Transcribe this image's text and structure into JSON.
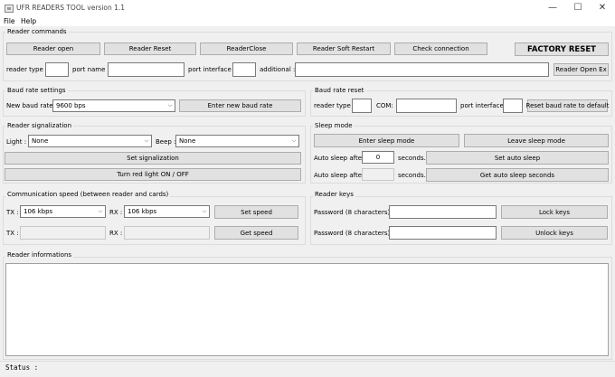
{
  "window": {
    "title": "UFR READERS TOOL version 1.1",
    "minimize_icon": "minimize-icon",
    "maximize_icon": "maximize-icon",
    "close_icon": "close-icon"
  },
  "menu": {
    "file": "File",
    "help": "Help"
  },
  "reader_commands": {
    "title": "Reader commands",
    "reader_open": "Reader open",
    "reader_reset": "Reader Reset",
    "reader_close": "ReaderClose",
    "reader_soft_restart": "Reader Soft Restart",
    "check_connection": "Check connection",
    "factory_reset": "FACTORY RESET",
    "reader_type_label": "reader type :",
    "reader_type_value": "",
    "port_name_label": "port name :",
    "port_name_value": "",
    "port_interface_label": "port interface :",
    "port_interface_value": "",
    "additional_label": "additional :",
    "additional_value": "",
    "reader_open_ex": "Reader Open Ex"
  },
  "baud_settings": {
    "title": "Baud rate settings",
    "new_baud_label": "New baud rate:",
    "new_baud_value": "9600 bps",
    "enter_new_baud": "Enter new baud rate"
  },
  "baud_reset": {
    "title": "Baud rate reset",
    "reader_type_label": "reader type",
    "reader_type_value": "",
    "com_label": "COM:",
    "com_value": "",
    "port_interface_label": "port interface:",
    "port_interface_value": "",
    "reset_button": "Reset baud rate to default"
  },
  "signalization": {
    "title": "Reader signalization",
    "light_label": "Light :",
    "light_value": "None",
    "beep_label": "Beep :",
    "beep_value": "None",
    "set_signalization": "Set signalization",
    "red_light": "Turn red light ON / OFF"
  },
  "sleep": {
    "title": "Sleep mode",
    "enter_sleep": "Enter sleep mode",
    "leave_sleep": "Leave sleep mode",
    "auto_sleep_after_label": "Auto sleep after",
    "auto_sleep_after_value": "0",
    "seconds_label": "seconds.",
    "set_auto_sleep": "Set auto sleep",
    "auto_sleep_after_label2": "Auto sleep after",
    "auto_sleep_after_value2": "",
    "seconds_label2": "seconds.",
    "get_auto_sleep": "Get auto sleep seconds"
  },
  "comm_speed": {
    "title": "Communication speed (between reader and cards)",
    "tx_label": "TX :",
    "tx_value": "106 kbps",
    "rx_label": "RX :",
    "rx_value": "106 kbps",
    "set_speed": "Set speed",
    "tx_label2": "TX :",
    "tx_value2": "",
    "rx_label2": "RX :",
    "rx_value2": "",
    "get_speed": "Get speed"
  },
  "reader_keys": {
    "title": "Reader keys",
    "password_label": "Password (8 characters) :",
    "password_value": "",
    "lock_keys": "Lock keys",
    "password_label2": "Password (8 characters) :",
    "password_value2": "",
    "unlock_keys": "Unlock keys"
  },
  "reader_info": {
    "title": "Reader informations",
    "content": ""
  },
  "status": {
    "label": "Status :",
    "value": ""
  }
}
